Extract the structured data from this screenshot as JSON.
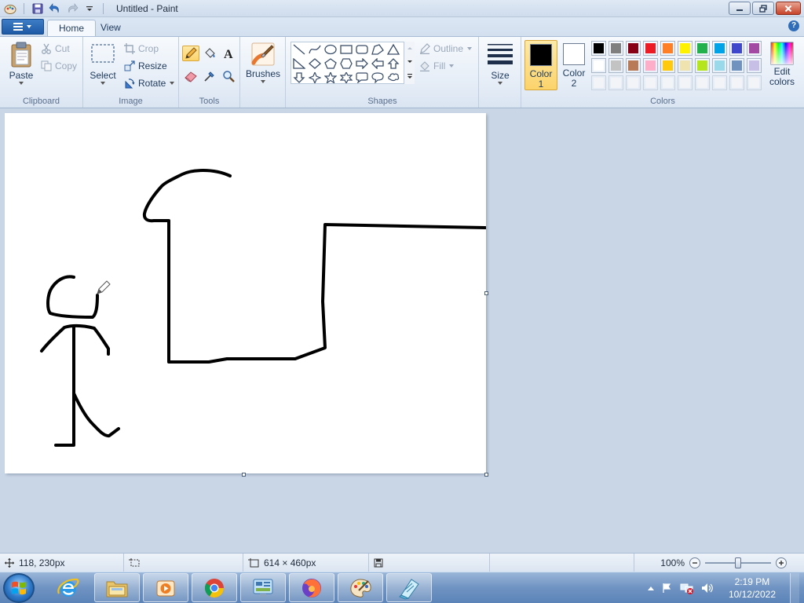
{
  "window": {
    "title": "Untitled - Paint"
  },
  "tabs": [
    {
      "label": "Home",
      "active": true
    },
    {
      "label": "View",
      "active": false
    }
  ],
  "ribbon": {
    "clipboard": {
      "label": "Clipboard",
      "paste": "Paste",
      "cut": "Cut",
      "copy": "Copy"
    },
    "image": {
      "label": "Image",
      "select": "Select",
      "crop": "Crop",
      "resize": "Resize",
      "rotate": "Rotate"
    },
    "tools": {
      "label": "Tools"
    },
    "brushes": {
      "label": "Brushes"
    },
    "shapes": {
      "label": "Shapes",
      "outline": "Outline",
      "fill": "Fill"
    },
    "size": {
      "label": "Size"
    },
    "colors": {
      "label": "Colors",
      "color1": {
        "label_line1": "Color",
        "label_line2": "1",
        "value": "#000000"
      },
      "color2": {
        "label_line1": "Color",
        "label_line2": "2",
        "value": "#ffffff"
      },
      "edit_line1": "Edit",
      "edit_line2": "colors",
      "palette_row1": [
        "#000000",
        "#7f7f7f",
        "#880015",
        "#ed1c24",
        "#ff7f27",
        "#fff200",
        "#22b14c",
        "#00a2e8",
        "#3f48cc",
        "#a349a4"
      ],
      "palette_row2": [
        "#ffffff",
        "#c3c3c3",
        "#b97a57",
        "#ffaec9",
        "#ffc90e",
        "#efe4b0",
        "#b5e61d",
        "#99d9ea",
        "#7092be",
        "#c8bfe7"
      ],
      "palette_row3": [
        "#f3f3f3",
        "#f3f3f3",
        "#f3f3f3",
        "#f3f3f3",
        "#f3f3f3",
        "#f3f3f3",
        "#f3f3f3",
        "#f3f3f3",
        "#f3f3f3",
        "#f3f3f3"
      ]
    }
  },
  "status": {
    "cursor_pos": "118, 230px",
    "selection_size": "",
    "canvas_size": "614 × 460px",
    "zoom": "100%",
    "zoom_level": 0.5
  },
  "taskbar": {
    "items": [
      {
        "name": "internet-explorer-icon",
        "open": false
      },
      {
        "name": "file-explorer-icon",
        "open": true
      },
      {
        "name": "media-player-icon",
        "open": true
      },
      {
        "name": "chrome-icon",
        "open": true
      },
      {
        "name": "control-panel-icon",
        "open": true
      },
      {
        "name": "firefox-icon",
        "open": true
      },
      {
        "name": "paint-icon",
        "open": true
      },
      {
        "name": "notepad-icon",
        "open": true
      }
    ],
    "time": "2:19 PM",
    "date": "10/12/2022"
  }
}
